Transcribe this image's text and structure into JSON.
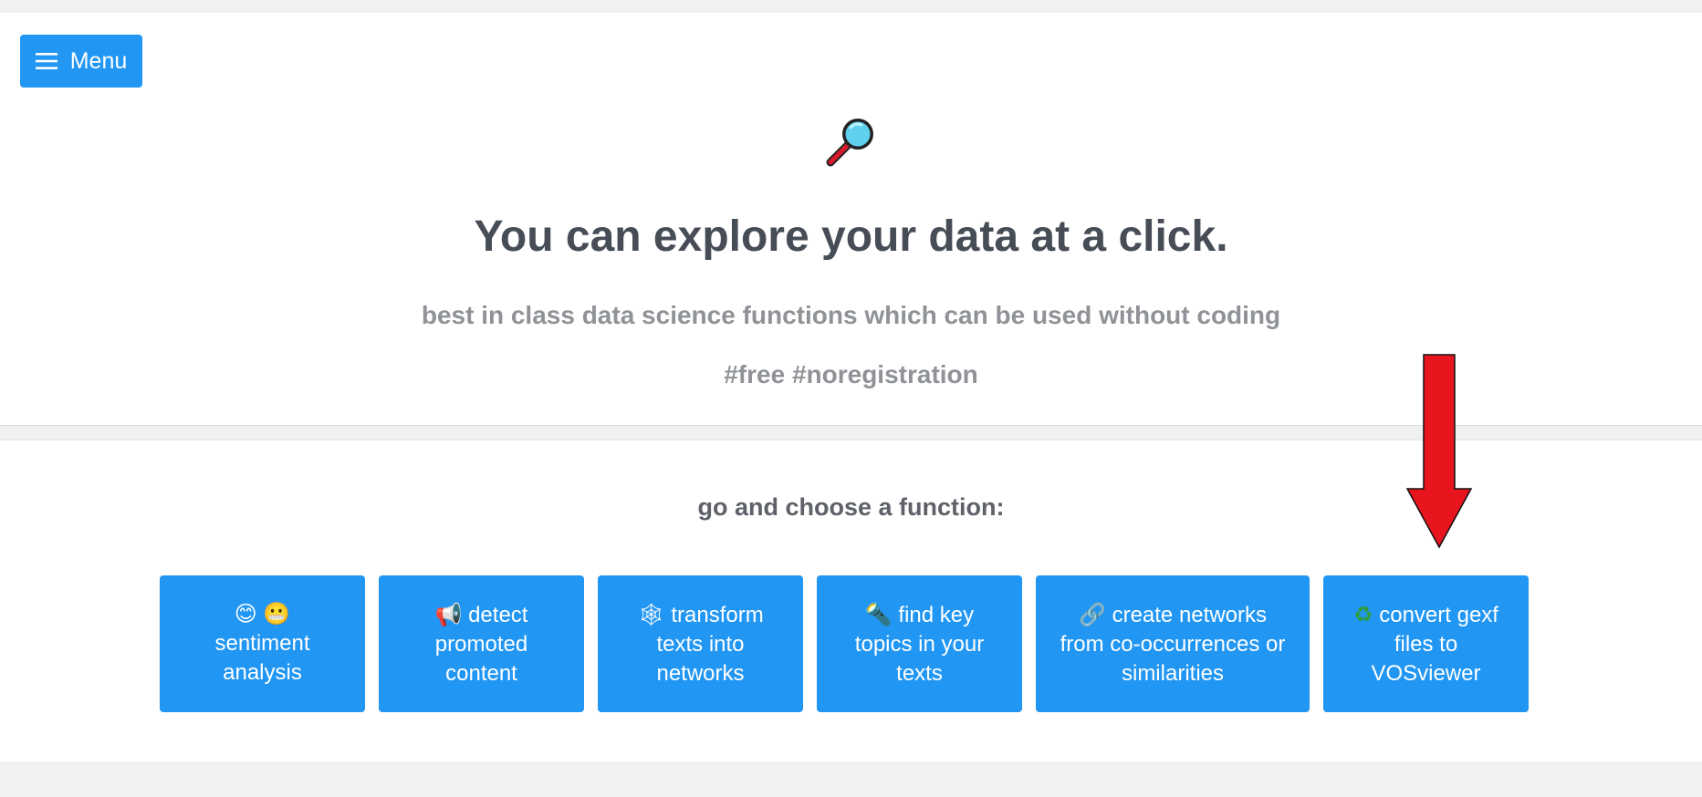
{
  "header": {
    "menu_label": "Menu"
  },
  "hero": {
    "icon": "magnifier-icon",
    "title": "You can explore your data at a click.",
    "subtitle": "best in class data science functions which can be used without coding",
    "tags": "#free #noregistration"
  },
  "functions": {
    "heading": "go and choose a function:",
    "items": [
      {
        "icons": "😊 😬",
        "lines": [
          "sentiment",
          "analysis"
        ]
      },
      {
        "icons": "📢",
        "lines": [
          "detect",
          "promoted",
          "content"
        ]
      },
      {
        "icons": "🕸",
        "lines": [
          "transform",
          "texts into",
          "networks"
        ]
      },
      {
        "icons": "🔦",
        "lines": [
          "find key",
          "topics in your",
          "texts"
        ]
      },
      {
        "icons": "🔗",
        "lines": [
          "create networks",
          "from co-occurrences or",
          "similarities"
        ]
      },
      {
        "icons": "♻",
        "lines": [
          "convert gexf",
          "files to",
          "VOSviewer"
        ]
      }
    ]
  },
  "colors": {
    "accent": "#2196f3",
    "title": "#474d57",
    "muted": "#8f9296",
    "arrow": "#e8151f"
  }
}
